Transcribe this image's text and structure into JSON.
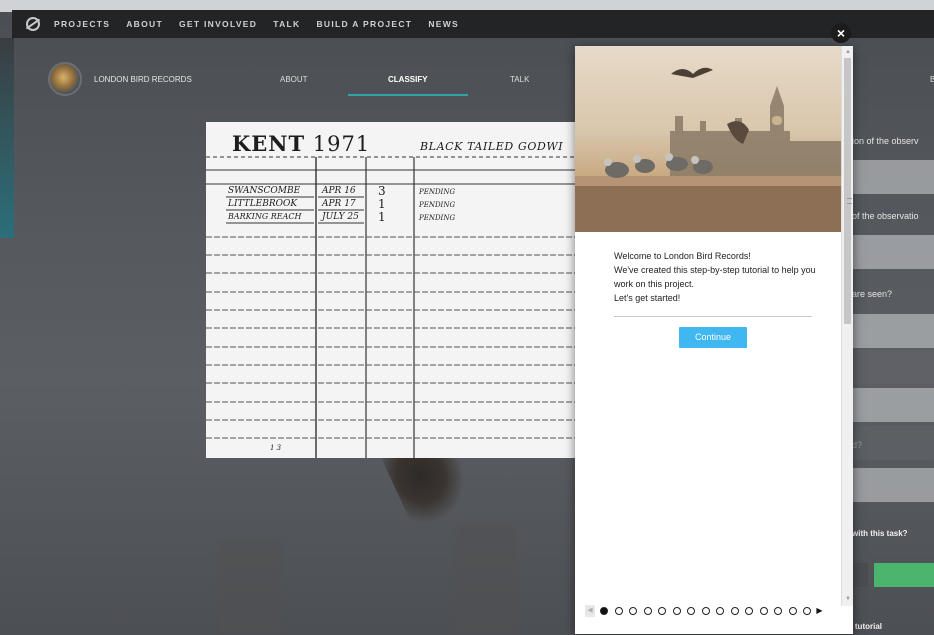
{
  "global_nav": {
    "items": [
      "PROJECTS",
      "ABOUT",
      "GET INVOLVED",
      "TALK",
      "BUILD A PROJECT",
      "NEWS"
    ]
  },
  "project_nav": {
    "title": "LONDON BIRD RECORDS",
    "about": "ABOUT",
    "classify": "CLASSIFY",
    "talk": "TALK",
    "edge_text": "B"
  },
  "subject": {
    "title_left": "KENT",
    "title_year": "1971",
    "species": "BLACK TAILED GODWI",
    "rows": [
      {
        "place": "SWANSCOMBE",
        "date": "APR 16",
        "count": "3",
        "status": "PENDING"
      },
      {
        "place": "LITTLEBROOK",
        "date": "APR 17",
        "count": "1",
        "status": "PENDING"
      },
      {
        "place": "BARKING REACH",
        "date": "JULY 25",
        "count": "1",
        "status": "PENDING"
      }
    ],
    "footer_mark": "1 3"
  },
  "task_panel": {
    "q1": "ion of the observ",
    "q2": "of the observatio",
    "q3": "are seen?",
    "q4": "d?",
    "help": "with this task?",
    "tutorial": "t tutorial"
  },
  "modal": {
    "close_glyph": "×",
    "lines": [
      "Welcome to London Bird Records!",
      "We've created this step-by-step tutorial to help you work on this project.",
      "Let's get started!"
    ],
    "continue_label": "Continue",
    "step_count": 15,
    "active_step": 0,
    "prev_glyph": "◀",
    "next_glyph": "▶"
  },
  "colors": {
    "accent_teal": "#2ea3a8",
    "continue_blue": "#3fb7f0",
    "done_green": "#4bb56e"
  }
}
